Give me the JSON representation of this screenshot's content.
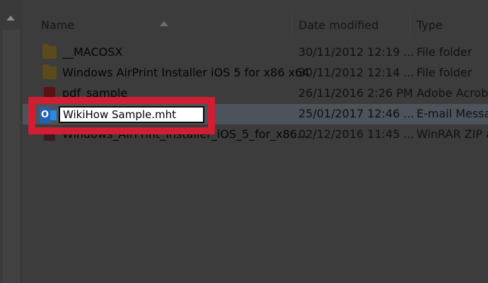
{
  "columns": {
    "name": "Name",
    "date_modified": "Date modified",
    "type": "Type"
  },
  "files": [
    {
      "name": "__MACOSX",
      "date": "30/11/2012 12:19 ...",
      "type": "File folder",
      "icon": "folder-icon"
    },
    {
      "name": "Windows AirPrint Installer iOS 5 for x86 x64",
      "date": "30/11/2012 12:14 ...",
      "type": "File folder",
      "icon": "folder-icon"
    },
    {
      "name": "pdf_sample",
      "date": "26/11/2016 2:26 PM",
      "type": "Adobe Acrobat",
      "icon": "pdf-icon"
    },
    {
      "name": "",
      "date": "25/01/2017 12:46 ...",
      "type": "E-mail Messag",
      "icon": "outlook-icon"
    },
    {
      "name": "Windows_AirPrint_Installer_iOS_5_for_x86...",
      "date": "02/12/2016 11:45 ...",
      "type": "WinRAR ZIP a",
      "icon": "zip-icon"
    }
  ],
  "rename": {
    "value": "WikiHow Sample.mht"
  },
  "colors": {
    "highlight": "#d11e33",
    "selected_row": "#4c535a"
  }
}
